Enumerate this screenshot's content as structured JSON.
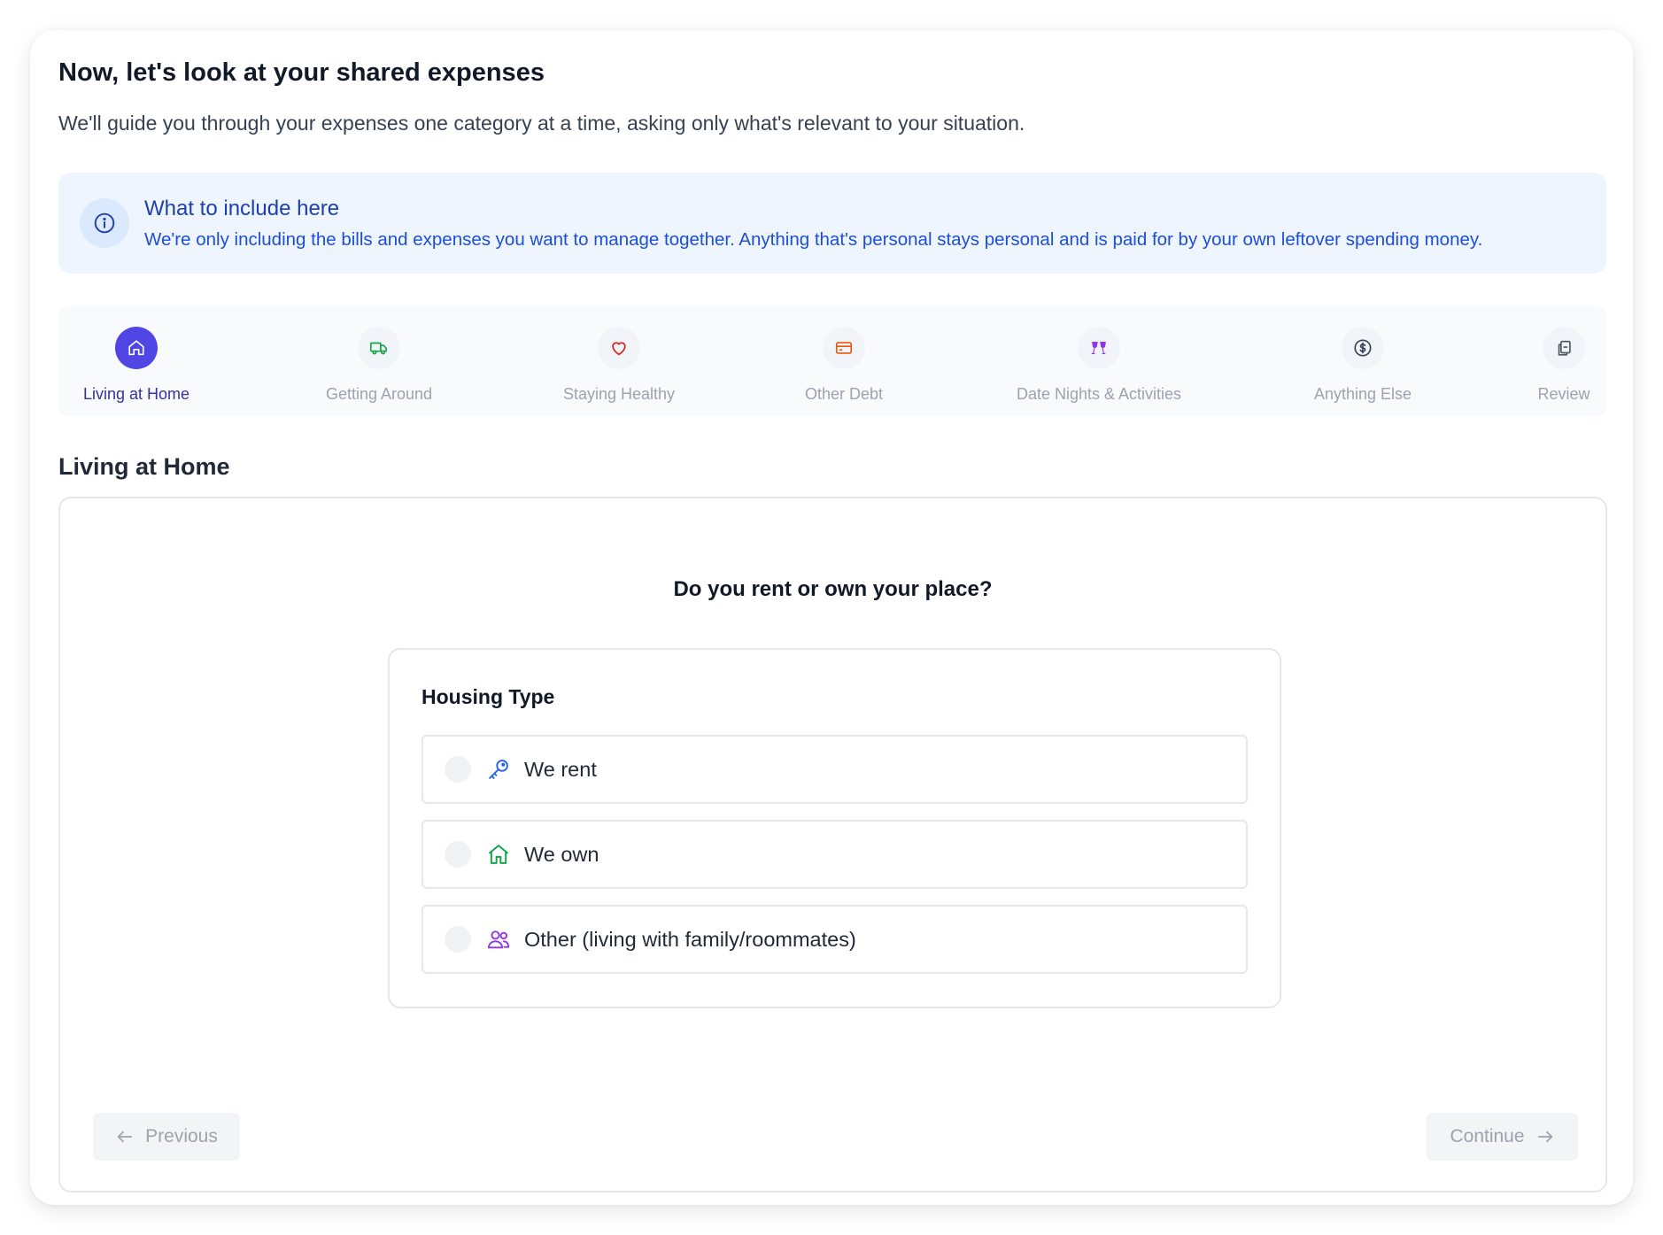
{
  "header": {
    "title": "Now, let's look at your shared expenses",
    "subtitle": "We'll guide you through your expenses one category at a time, asking only what's relevant to your situation."
  },
  "info": {
    "icon": "info-icon",
    "title": "What to include here",
    "text": "We're only including the bills and expenses you want to manage together. Anything that's personal stays personal and is paid for by your own leftover spending money."
  },
  "steps": [
    {
      "label": "Living at Home",
      "icon": "home-icon",
      "active": true,
      "color": "#ffffff"
    },
    {
      "label": "Getting Around",
      "icon": "truck-icon",
      "active": false,
      "color": "#16a34a"
    },
    {
      "label": "Staying Healthy",
      "icon": "heart-icon",
      "active": false,
      "color": "#dc2626"
    },
    {
      "label": "Other Debt",
      "icon": "credit-card-icon",
      "active": false,
      "color": "#ea580c"
    },
    {
      "label": "Date Nights & Activities",
      "icon": "glasses-cheers-icon",
      "active": false,
      "color": "#9333ea"
    },
    {
      "label": "Anything Else",
      "icon": "dollar-circle-icon",
      "active": false,
      "color": "#374151"
    },
    {
      "label": "Review",
      "icon": "clipboard-copy-icon",
      "active": false,
      "color": "#4b5563"
    }
  ],
  "section": {
    "title": "Living at Home",
    "question": "Do you rent or own your place?",
    "group_title": "Housing Type",
    "options": [
      {
        "label": "We rent",
        "icon": "key-icon",
        "color": "#2563eb"
      },
      {
        "label": "We own",
        "icon": "home-icon",
        "color": "#16a34a"
      },
      {
        "label": "Other (living with family/roommates)",
        "icon": "users-icon",
        "color": "#9333ea"
      }
    ]
  },
  "nav": {
    "previous_label": "Previous",
    "continue_label": "Continue"
  },
  "colors": {
    "accent": "#4f46e5",
    "info_bg": "#eef5ff",
    "info_text": "#1d4ed8"
  }
}
